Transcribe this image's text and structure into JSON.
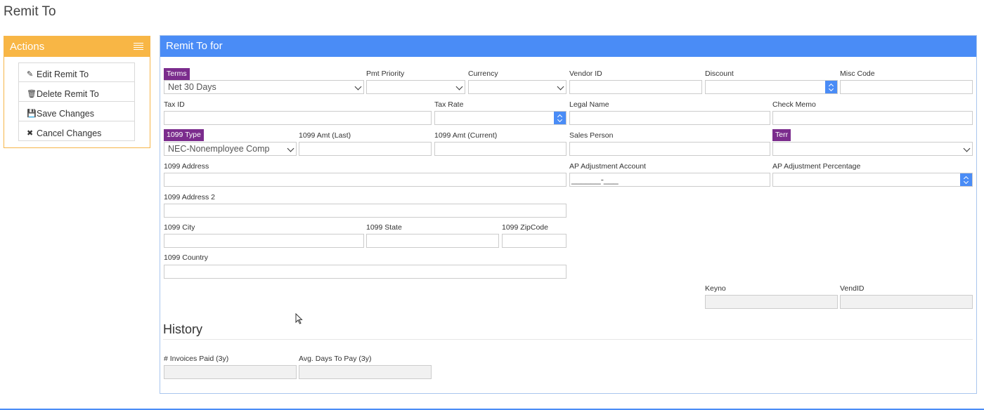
{
  "page": {
    "title": "Remit To"
  },
  "actions": {
    "title": "Actions",
    "items": [
      {
        "label": "Edit Remit To",
        "icon": "pencil-icon"
      },
      {
        "label": "Delete Remit To",
        "icon": "trash-icon"
      },
      {
        "label": "Save Changes",
        "icon": "save-icon"
      },
      {
        "label": "Cancel Changes",
        "icon": "close-icon"
      }
    ]
  },
  "panel": {
    "title": "Remit To for"
  },
  "form": {
    "terms": {
      "label": "Terms",
      "value": "Net 30 Days"
    },
    "pmt_priority": {
      "label": "Pmt Priority",
      "value": ""
    },
    "currency": {
      "label": "Currency",
      "value": ""
    },
    "vendor_id": {
      "label": "Vendor ID",
      "value": ""
    },
    "discount": {
      "label": "Discount",
      "value": ""
    },
    "misc_code": {
      "label": "Misc Code",
      "value": ""
    },
    "tax_id": {
      "label": "Tax ID",
      "value": ""
    },
    "tax_rate": {
      "label": "Tax Rate",
      "value": ""
    },
    "legal_name": {
      "label": "Legal Name",
      "value": ""
    },
    "check_memo": {
      "label": "Check Memo",
      "value": ""
    },
    "type_1099": {
      "label": "1099 Type",
      "value": "NEC-Nonemployee Comp"
    },
    "amt_last_1099": {
      "label": "1099 Amt (Last)",
      "value": ""
    },
    "amt_current_1099": {
      "label": "1099 Amt (Current)",
      "value": ""
    },
    "sales_person": {
      "label": "Sales Person",
      "value": ""
    },
    "terr": {
      "label": "Terr",
      "value": ""
    },
    "address_1099": {
      "label": "1099 Address",
      "value": ""
    },
    "ap_adjustment_account": {
      "label": "AP Adjustment Account",
      "value": "______-___"
    },
    "ap_adjustment_percentage": {
      "label": "AP Adjustment Percentage",
      "value": ""
    },
    "address2_1099": {
      "label": "1099 Address 2",
      "value": ""
    },
    "city_1099": {
      "label": "1099 City",
      "value": ""
    },
    "state_1099": {
      "label": "1099 State",
      "value": ""
    },
    "zip_1099": {
      "label": "1099 ZipCode",
      "value": ""
    },
    "country_1099": {
      "label": "1099 Country",
      "value": ""
    },
    "keyno": {
      "label": "Keyno",
      "value": ""
    },
    "vendid": {
      "label": "VendID",
      "value": ""
    }
  },
  "history": {
    "title": "History",
    "invoices_paid": {
      "label": "# Invoices Paid (3y)",
      "value": ""
    },
    "avg_days_to_pay": {
      "label": "Avg. Days To Pay (3y)",
      "value": ""
    }
  },
  "colors": {
    "actions_header": "#f8b645",
    "panel_header": "#4a8cf6",
    "required_badge": "#7b2c8d"
  }
}
